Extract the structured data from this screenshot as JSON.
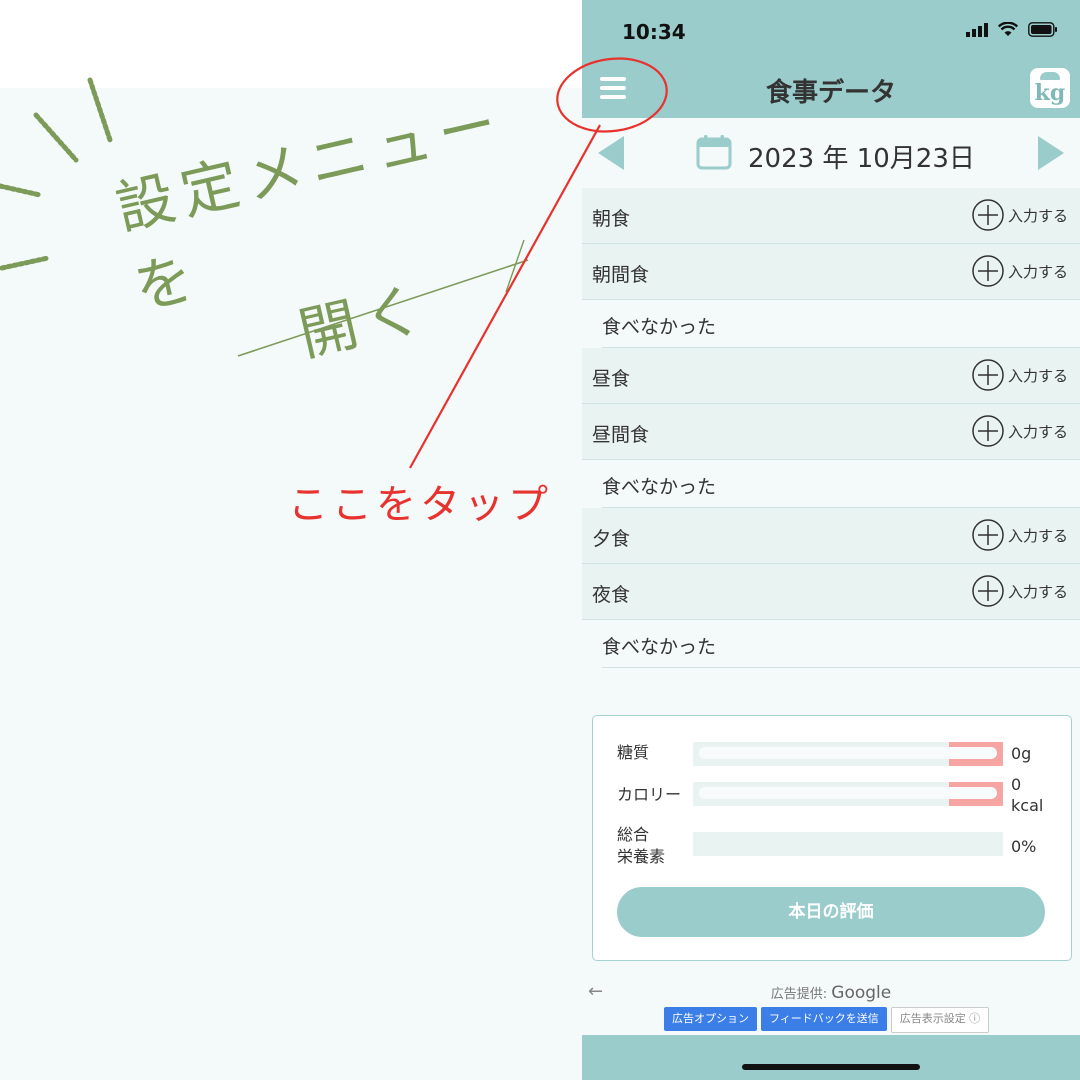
{
  "annotation": {
    "title_line1": "設定メニューを",
    "title_line2": "開く",
    "tap_hint": "ここをタップ",
    "colors": {
      "title": "#7c9a58",
      "hint": "#e8322e"
    }
  },
  "status_bar": {
    "time": "10:34"
  },
  "nav": {
    "title": "食事データ",
    "kg_label": "kg",
    "menu_icon": "hamburger-icon"
  },
  "date": {
    "text": "2023 年 10月23日"
  },
  "meals": [
    {
      "label": "朝食",
      "add": "入力する"
    },
    {
      "label": "朝間食",
      "add": "入力する",
      "note": "食べなかった"
    },
    {
      "label": "昼食",
      "add": "入力する"
    },
    {
      "label": "昼間食",
      "add": "入力する",
      "note": "食べなかった"
    },
    {
      "label": "夕食",
      "add": "入力する"
    },
    {
      "label": "夜食",
      "add": "入力する",
      "note": "食べなかった"
    }
  ],
  "summary": {
    "carbs": {
      "label": "糖質",
      "value": "0g"
    },
    "calories": {
      "label": "カロリー",
      "value_line1": "0",
      "value_line2": "kcal"
    },
    "nutrition": {
      "label_line1": "総合",
      "label_line2": "栄養素",
      "value": "0%"
    },
    "eval_button": "本日の評価"
  },
  "ad": {
    "provider_prefix": "広告提供: ",
    "provider_name": "Google",
    "options": "広告オプション",
    "feedback": "フィードバックを送信",
    "settings": "広告表示設定 ⓘ"
  },
  "theme": {
    "primary": "#99cccb",
    "row_bg": "#e9f3f2",
    "bar_cap": "#f6a5a2"
  }
}
